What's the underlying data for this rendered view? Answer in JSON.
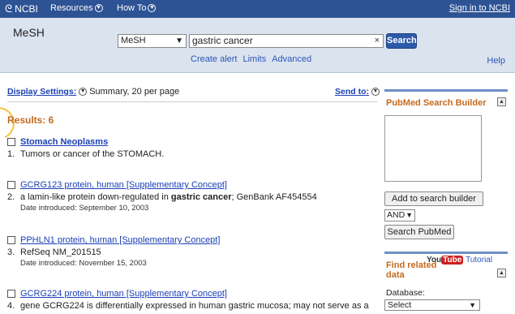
{
  "topbar": {
    "logo_text": "NCBI",
    "resources_label": "Resources",
    "howto_label": "How To",
    "signin_label": "Sign in to NCBI"
  },
  "search": {
    "db_title": "MeSH",
    "db_selected": "MeSH",
    "query": "gastric cancer",
    "clear_glyph": "×",
    "button_label": "Search",
    "links": [
      "Create alert",
      "Limits",
      "Advanced"
    ],
    "help_label": "Help"
  },
  "display": {
    "settings_label": "Display Settings:",
    "settings_value": "Summary, 20 per page",
    "sendto_label": "Send to:"
  },
  "results": {
    "title": "Results: 6",
    "items": [
      {
        "num": "1.",
        "title": "Stomach Neoplasms",
        "desc": "Tumors or cancer of the STOMACH.",
        "date": ""
      },
      {
        "num": "2.",
        "title": "GCRG123 protein, human [Supplementary Concept]",
        "desc_pre": "a lamin-like protein down-regulated in ",
        "desc_bold": "gastric cancer",
        "desc_post": "; GenBank AF454554",
        "date": "Date introduced: September 10, 2003"
      },
      {
        "num": "3.",
        "title": "PPHLN1 protein, human [Supplementary Concept]",
        "desc": "RefSeq NM_201515",
        "date": "Date introduced: November 15, 2003"
      },
      {
        "num": "4.",
        "title": "GCRG224 protein, human [Supplementary Concept]",
        "desc": "gene GCRG224 is differentially expressed in human gastric mucosa; may not serve as a"
      }
    ]
  },
  "sidebar": {
    "builder_title": "PubMed Search Builder",
    "add_button": "Add to search builder",
    "operator": "AND",
    "search_pubmed_button": "Search PubMed",
    "youtube_you": "You",
    "youtube_tube": "Tube",
    "tutorial_label": "Tutorial",
    "find_title_1": "Find related",
    "find_title_2": "data",
    "database_label": "Database:",
    "database_selected": "Select"
  },
  "colors": {
    "topbar_bg": "#2d5394",
    "searchbar_bg": "#dbe3ef",
    "link": "#1a3fb5",
    "accent_orange": "#c46a1e",
    "search_button": "#2d5aa8"
  }
}
